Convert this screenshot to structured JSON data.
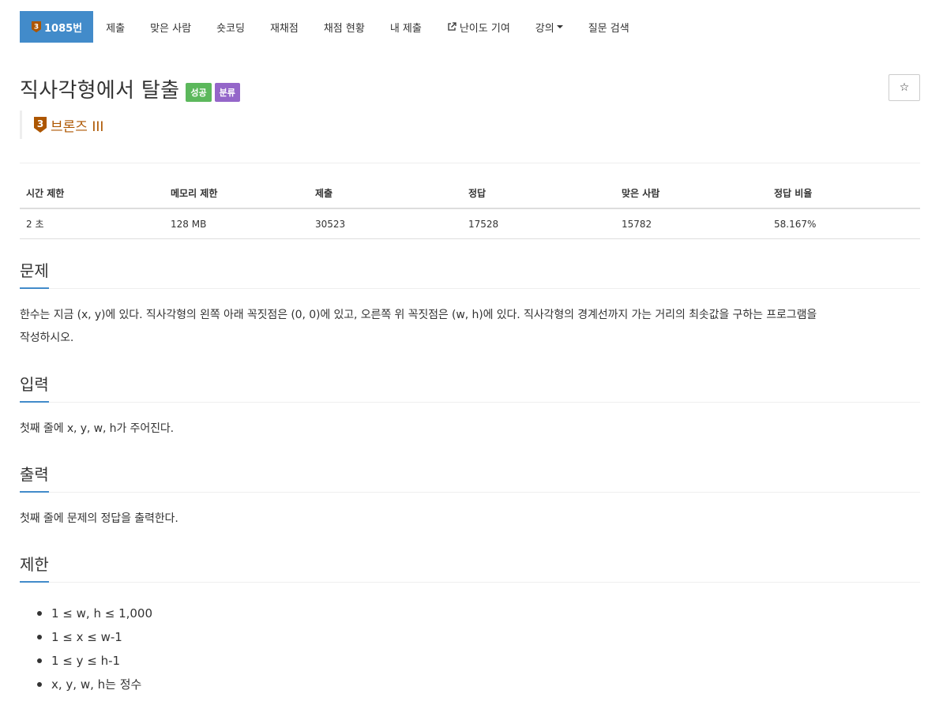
{
  "nav": {
    "problem_number": "1085번",
    "tier_digit": "3",
    "items": [
      {
        "label": "제출"
      },
      {
        "label": "맞은 사람"
      },
      {
        "label": "숏코딩"
      },
      {
        "label": "재채점"
      },
      {
        "label": "채점 현황"
      },
      {
        "label": "내 제출"
      },
      {
        "label": "난이도 기여"
      },
      {
        "label": "강의"
      },
      {
        "label": "질문 검색"
      }
    ]
  },
  "problem": {
    "title": "직사각형에서 탈출",
    "labels": {
      "success": "성공",
      "classification": "분류"
    },
    "tier": "브론즈 III",
    "star": "☆"
  },
  "info_table": {
    "headers": [
      "시간 제한",
      "메모리 제한",
      "제출",
      "정답",
      "맞은 사람",
      "정답 비율"
    ],
    "values": [
      "2 초",
      "128 MB",
      "30523",
      "17528",
      "15782",
      "58.167%"
    ]
  },
  "sections": {
    "description": {
      "title": "문제",
      "text": "한수는 지금 (x, y)에 있다. 직사각형의 왼쪽 아래 꼭짓점은 (0, 0)에 있고, 오른쪽 위 꼭짓점은 (w, h)에 있다. 직사각형의 경계선까지 가는 거리의 최솟값을 구하는 프로그램을",
      "text2": "작성하시오."
    },
    "input": {
      "title": "입력",
      "text": "첫째 줄에 x, y, w, h가 주어진다."
    },
    "output": {
      "title": "출력",
      "text": "첫째 줄에 문제의 정답을 출력한다."
    },
    "limits": {
      "title": "제한",
      "items": [
        "1 ≤ w, h ≤ 1,000",
        "1 ≤ x ≤ w-1",
        "1 ≤ y ≤ h-1",
        "x, y, w, h는 정수"
      ]
    }
  },
  "colors": {
    "nav_active": "#428bca",
    "label_success": "#5cb85c",
    "label_class": "#9466c9",
    "tier_bronze": "#ad5600"
  }
}
